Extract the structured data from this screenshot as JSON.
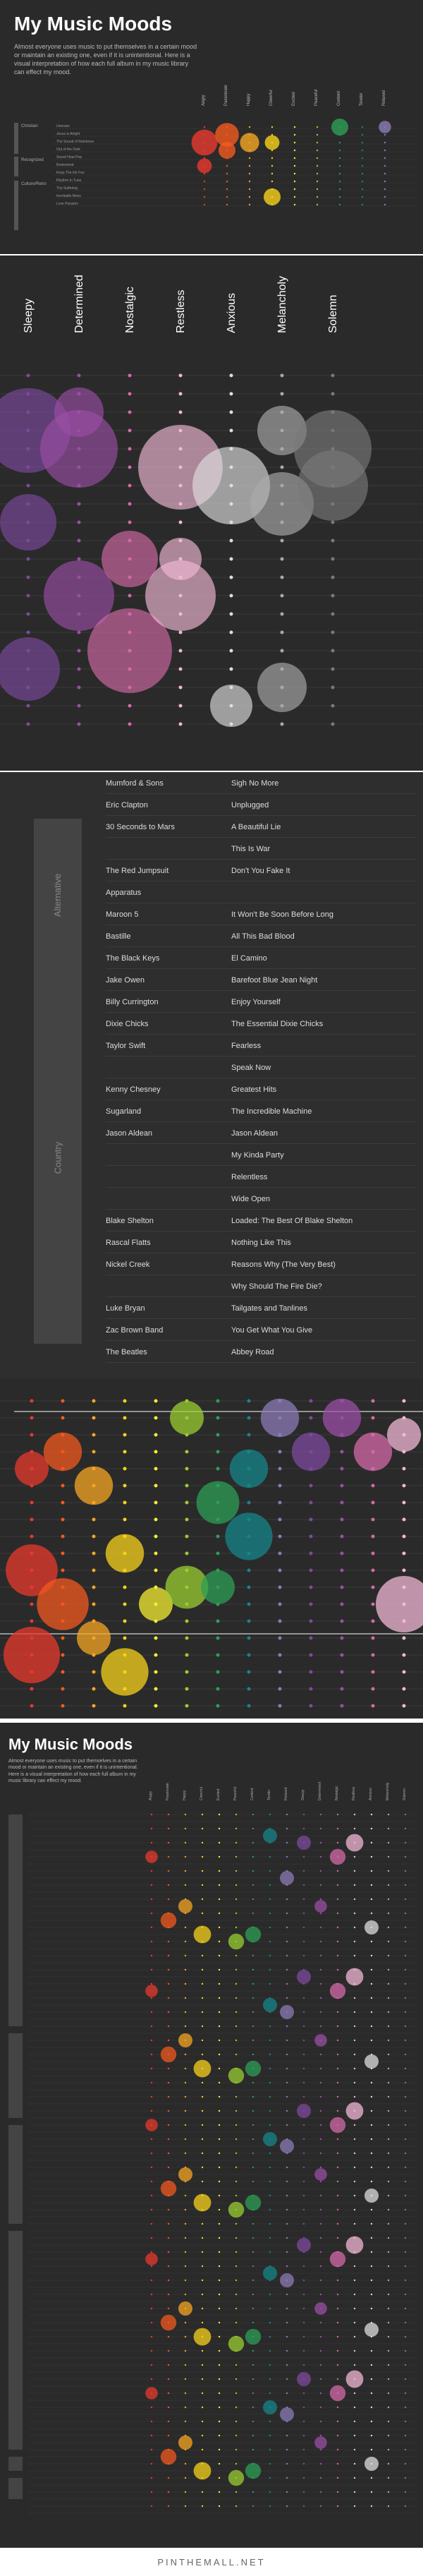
{
  "page_title": "My Music Moods",
  "intro_text": "Almost everyone uses music to put themselves in a certain mood or maintain an existing one, even if it is unintentional. Here is a visual interpretation of how each full album in my music library can effect my mood.",
  "footer_text": "PINTHEMALL.NET",
  "colors": {
    "background": "#2a2a2a",
    "Angry": "#e8392e",
    "Passionate": "#f25a1f",
    "Happy": "#f5a623",
    "Cheerful": "#f7d21b",
    "Excited": "#f4ee31",
    "Peaceful": "#9acd32",
    "Content": "#2e9e55",
    "Tender": "#15868a",
    "Relaxed": "#8c7bb5",
    "Sleepy": "#7d4a9e",
    "Determined": "#9b4fa5",
    "Nostalgic": "#d46aa8",
    "Restless": "#f2b8d6",
    "Anxious": "#dddddd",
    "Melancholy": "#aaaaaa",
    "Solemn": "#7a7a7a"
  },
  "moods_top": [
    "Angry",
    "Passionate",
    "Happy",
    "Cheerful",
    "Excited",
    "Peaceful",
    "Content",
    "Tender",
    "Relaxed"
  ],
  "moods_zoom": [
    "Sleepy",
    "Determined",
    "Nostalgic",
    "Restless",
    "Anxious",
    "Melancholy",
    "Solemn"
  ],
  "top_genres": [
    "Christian",
    "Recognized",
    "Culture/Retro"
  ],
  "top_rows": [
    "Unerase",
    "Jesus is Alright",
    "The Sound of Rainbows",
    "Out of the Dark",
    "Sweet Heat Pop",
    "Redeemed",
    "Keep The Ink Fun",
    "Rhythm In Tune",
    "The Suffering",
    "Inevitable Mess",
    "Love Paradox"
  ],
  "list_rows": [
    {
      "artist": "Mumford & Sons",
      "album": "Sigh No More"
    },
    {
      "artist": "Eric Clapton",
      "album": "Unplugged"
    },
    {
      "artist": "30 Seconds to Mars",
      "album": "A Beautiful Lie"
    },
    {
      "artist": "",
      "album": "This Is War"
    },
    {
      "artist": "The Red Jumpsuit",
      "album": "Don't You Fake It"
    },
    {
      "artist": "Apparatus",
      "album": ""
    },
    {
      "artist": "Maroon 5",
      "album": "It Won't Be Soon Before Long"
    },
    {
      "artist": "Bastille",
      "album": "All This Bad Blood"
    },
    {
      "artist": "The Black Keys",
      "album": "El Camino"
    },
    {
      "artist": "Jake Owen",
      "album": "Barefoot Blue Jean Night"
    },
    {
      "artist": "Billy Currington",
      "album": "Enjoy Yourself"
    },
    {
      "artist": "Dixie Chicks",
      "album": "The Essential Dixie Chicks"
    },
    {
      "artist": "Taylor Swift",
      "album": "Fearless"
    },
    {
      "artist": "",
      "album": "Speak Now"
    },
    {
      "artist": "Kenny Chesney",
      "album": "Greatest Hits"
    },
    {
      "artist": "Sugarland",
      "album": "The Incredible Machine"
    },
    {
      "artist": "Jason Aldean",
      "album": "Jason Aldean"
    },
    {
      "artist": "",
      "album": "My Kinda Party"
    },
    {
      "artist": "",
      "album": "Relentless"
    },
    {
      "artist": "",
      "album": "Wide Open"
    },
    {
      "artist": "Blake Shelton",
      "album": "Loaded: The Best Of Blake Shelton"
    },
    {
      "artist": "Rascal Flatts",
      "album": "Nothing Like This"
    },
    {
      "artist": "Nickel Creek",
      "album": "Reasons Why (The Very Best)"
    },
    {
      "artist": "",
      "album": "Why Should The Fire Die?"
    },
    {
      "artist": "Luke Bryan",
      "album": "Tailgates and Tanlines"
    },
    {
      "artist": "Zac Brown Band",
      "album": "You Get What You Give"
    },
    {
      "artist": "The Beatles",
      "album": "Abbey Road"
    }
  ],
  "list_genres": [
    "Alternative",
    "Country"
  ],
  "chart_data": [
    {
      "type": "scatter",
      "title": "My Music Moods (top)",
      "xlabel": "",
      "ylabel": "",
      "categories": [
        "Angry",
        "Passionate",
        "Happy",
        "Cheerful",
        "Excited",
        "Peaceful",
        "Content",
        "Tender",
        "Relaxed"
      ],
      "points": [
        {
          "cat": "Angry",
          "row": 2,
          "size": 0.9
        },
        {
          "cat": "Angry",
          "row": 5,
          "size": 0.4
        },
        {
          "cat": "Passionate",
          "row": 1,
          "size": 0.8
        },
        {
          "cat": "Passionate",
          "row": 3,
          "size": 0.5
        },
        {
          "cat": "Happy",
          "row": 2,
          "size": 0.6
        },
        {
          "cat": "Cheerful",
          "row": 2,
          "size": 0.4
        },
        {
          "cat": "Cheerful",
          "row": 9,
          "size": 0.5
        },
        {
          "cat": "Content",
          "row": 0,
          "size": 0.5
        },
        {
          "cat": "Relaxed",
          "row": 0,
          "size": 0.3
        }
      ]
    },
    {
      "type": "scatter",
      "title": "",
      "xlabel": "",
      "ylabel": "",
      "categories": [
        "Sleepy",
        "Determined",
        "Nostalgic",
        "Restless",
        "Anxious",
        "Melancholy",
        "Solemn"
      ],
      "points": [
        {
          "cat": "Sleepy",
          "row": 3,
          "size": 1.0
        },
        {
          "cat": "Sleepy",
          "row": 8,
          "size": 0.6
        },
        {
          "cat": "Sleepy",
          "row": 16,
          "size": 0.7
        },
        {
          "cat": "Determined",
          "row": 2,
          "size": 0.5
        },
        {
          "cat": "Determined",
          "row": 4,
          "size": 0.9
        },
        {
          "cat": "Determined",
          "row": 12,
          "size": 0.8
        },
        {
          "cat": "Nostalgic",
          "row": 10,
          "size": 0.6
        },
        {
          "cat": "Nostalgic",
          "row": 15,
          "size": 1.0
        },
        {
          "cat": "Restless",
          "row": 5,
          "size": 1.0
        },
        {
          "cat": "Restless",
          "row": 10,
          "size": 0.4
        },
        {
          "cat": "Restless",
          "row": 12,
          "size": 0.8
        },
        {
          "cat": "Anxious",
          "row": 6,
          "size": 0.9
        },
        {
          "cat": "Anxious",
          "row": 18,
          "size": 0.4
        },
        {
          "cat": "Melancholy",
          "row": 3,
          "size": 0.5
        },
        {
          "cat": "Melancholy",
          "row": 7,
          "size": 0.7
        },
        {
          "cat": "Melancholy",
          "row": 17,
          "size": 0.5
        },
        {
          "cat": "Solemn",
          "row": 4,
          "size": 0.9
        },
        {
          "cat": "Solemn",
          "row": 6,
          "size": 0.8
        }
      ]
    },
    {
      "type": "scatter",
      "title": "",
      "xlabel": "",
      "ylabel": "",
      "categories": [
        "Angry",
        "Passionate",
        "Happy",
        "Cheerful",
        "Excited",
        "Peaceful",
        "Content",
        "Tender",
        "Relaxed",
        "Sleepy",
        "Determined",
        "Nostalgic",
        "Restless"
      ],
      "points": [
        {
          "cat": "Angry",
          "row": 4,
          "size": 0.5
        },
        {
          "cat": "Angry",
          "row": 10,
          "size": 0.9
        },
        {
          "cat": "Angry",
          "row": 15,
          "size": 1.0
        },
        {
          "cat": "Passionate",
          "row": 3,
          "size": 0.6
        },
        {
          "cat": "Passionate",
          "row": 12,
          "size": 0.9
        },
        {
          "cat": "Happy",
          "row": 5,
          "size": 0.6
        },
        {
          "cat": "Happy",
          "row": 14,
          "size": 0.5
        },
        {
          "cat": "Cheerful",
          "row": 9,
          "size": 0.6
        },
        {
          "cat": "Cheerful",
          "row": 16,
          "size": 0.8
        },
        {
          "cat": "Excited",
          "row": 12,
          "size": 0.5
        },
        {
          "cat": "Peaceful",
          "row": 11,
          "size": 0.7
        },
        {
          "cat": "Peaceful",
          "row": 1,
          "size": 0.5
        },
        {
          "cat": "Content",
          "row": 6,
          "size": 0.7
        },
        {
          "cat": "Content",
          "row": 11,
          "size": 0.5
        },
        {
          "cat": "Tender",
          "row": 4,
          "size": 0.6
        },
        {
          "cat": "Tender",
          "row": 8,
          "size": 0.8
        },
        {
          "cat": "Relaxed",
          "row": 1,
          "size": 0.6
        },
        {
          "cat": "Sleepy",
          "row": 3,
          "size": 0.6
        },
        {
          "cat": "Determined",
          "row": 1,
          "size": 0.6
        },
        {
          "cat": "Nostalgic",
          "row": 3,
          "size": 0.6
        },
        {
          "cat": "Restless",
          "row": 12,
          "size": 1.0
        },
        {
          "cat": "Restless",
          "row": 2,
          "size": 0.5
        }
      ]
    },
    {
      "type": "scatter",
      "title": "My Music Moods",
      "xlabel": "",
      "ylabel": "",
      "categories": [
        "Angry",
        "Passionate",
        "Happy",
        "Cheerful",
        "Excited",
        "Peaceful",
        "Content",
        "Tender",
        "Relaxed",
        "Sleepy",
        "Determined",
        "Nostalgic",
        "Restless",
        "Anxious",
        "Melancholy",
        "Solemn"
      ],
      "points": [
        {
          "cat": "Angry",
          "row": 6,
          "size": 0.4
        },
        {
          "cat": "Passionate",
          "row": 8,
          "size": 0.6
        },
        {
          "cat": "Happy",
          "row": 10,
          "size": 0.5
        },
        {
          "cat": "Cheerful",
          "row": 7,
          "size": 0.7
        },
        {
          "cat": "Peaceful",
          "row": 12,
          "size": 0.6
        },
        {
          "cat": "Content",
          "row": 15,
          "size": 0.6
        },
        {
          "cat": "Tender",
          "row": 18,
          "size": 0.5
        },
        {
          "cat": "Relaxed",
          "row": 4,
          "size": 0.5
        },
        {
          "cat": "Sleepy",
          "row": 3,
          "size": 0.5
        },
        {
          "cat": "Determined",
          "row": 5,
          "size": 0.4
        },
        {
          "cat": "Nostalgic",
          "row": 2,
          "size": 0.6
        },
        {
          "cat": "Restless",
          "row": 4,
          "size": 0.7
        },
        {
          "cat": "Anxious",
          "row": 9,
          "size": 0.5
        }
      ]
    }
  ]
}
